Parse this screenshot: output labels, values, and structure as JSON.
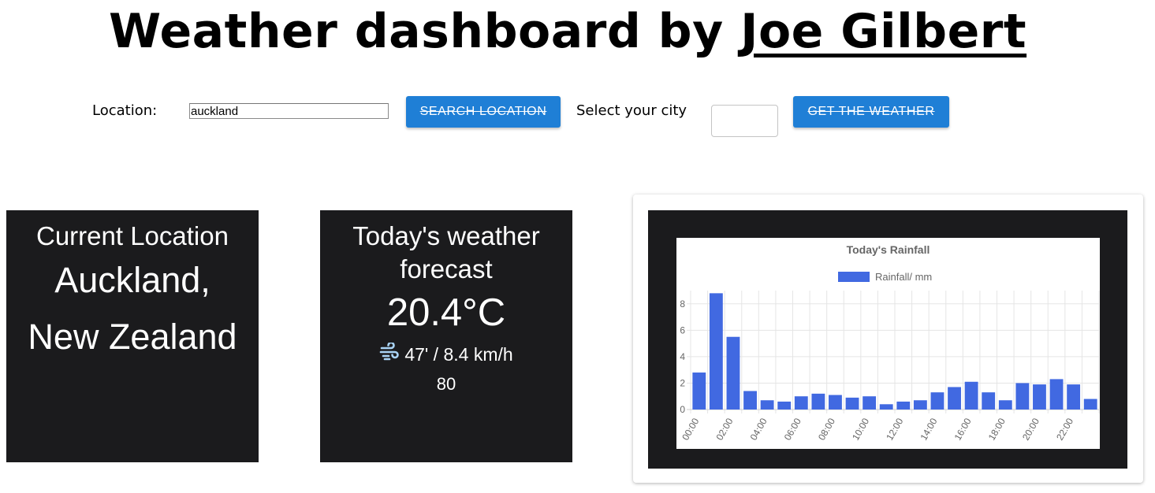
{
  "header": {
    "title_prefix": "Weather dashboard by ",
    "author": "Joe Gilbert"
  },
  "search": {
    "label": "Location:",
    "value": "auckland",
    "button_label": "Search Location"
  },
  "city": {
    "label": "Select your city",
    "selected": "",
    "button_label": "Get the weather"
  },
  "location_card": {
    "heading": "Current Location",
    "city": "Auckland,",
    "country": "New Zealand"
  },
  "forecast_card": {
    "heading": "Today's weather forecast",
    "temperature": "20.4°C",
    "wind_icon": "wind-icon",
    "wind": "47' / 8.4 km/h",
    "extra_value": "80"
  },
  "colors": {
    "button_blue": "#1f7fd6",
    "card_bg": "#1b1b1d",
    "bar_color": "#4169e1"
  },
  "chart_data": {
    "type": "bar",
    "title": "Today's Rainfall",
    "xlabel": "",
    "ylabel": "",
    "categories": [
      "00:00",
      "01:00",
      "02:00",
      "03:00",
      "04:00",
      "05:00",
      "06:00",
      "07:00",
      "08:00",
      "09:00",
      "10:00",
      "11:00",
      "12:00",
      "13:00",
      "14:00",
      "15:00",
      "16:00",
      "17:00",
      "18:00",
      "19:00",
      "20:00",
      "21:00",
      "22:00",
      "23:00"
    ],
    "x_tick_labels": [
      "00:00",
      "02:00",
      "04:00",
      "06:00",
      "08:00",
      "10:00",
      "12:00",
      "14:00",
      "16:00",
      "18:00",
      "20:00",
      "22:00"
    ],
    "series": [
      {
        "name": "Rainfall/ mm",
        "values": [
          2.8,
          8.8,
          5.5,
          1.4,
          0.7,
          0.6,
          1.0,
          1.2,
          1.1,
          0.9,
          1.0,
          0.4,
          0.6,
          0.7,
          1.3,
          1.7,
          2.1,
          1.3,
          0.7,
          2.0,
          1.9,
          2.3,
          1.9,
          0.8
        ]
      }
    ],
    "ylim": [
      0,
      9
    ],
    "y_ticks": [
      0,
      2,
      4,
      6,
      8
    ],
    "grid": true,
    "legend": "top"
  }
}
